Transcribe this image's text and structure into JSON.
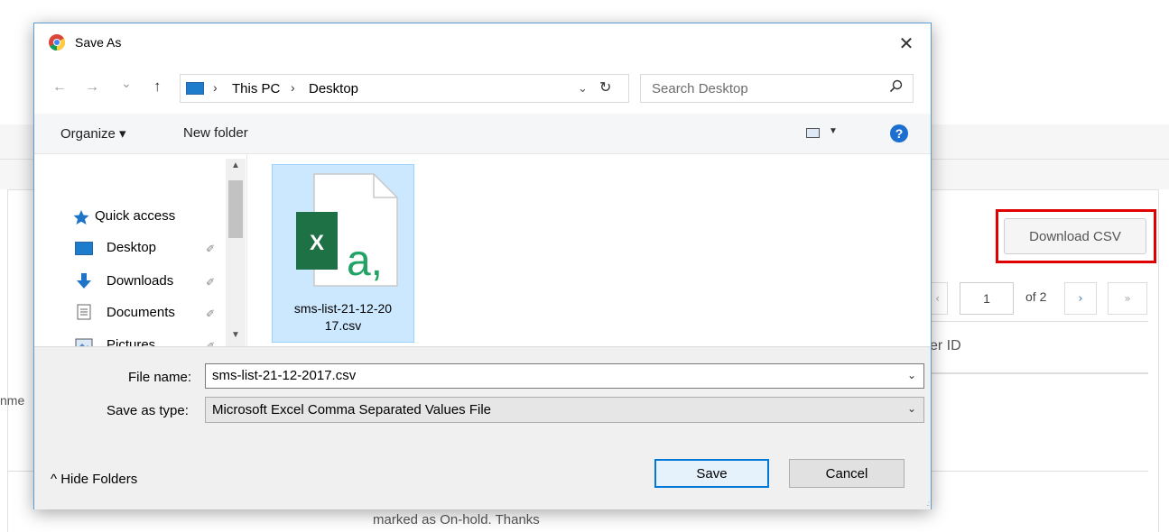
{
  "background": {
    "download_csv_label": "Download CSV",
    "pagination": {
      "prev": "‹",
      "current_page": "1",
      "of_label": "of 2",
      "next": "›",
      "last": "»"
    },
    "table_header_partial": "er ID",
    "left_cut_text": "nme",
    "row_text": "marked as On-hold. Thanks",
    "highlight_color": "#e00000"
  },
  "dialog": {
    "title": "Save As",
    "close_label": "✕",
    "nav": {
      "back": "←",
      "forward": "→",
      "recent": "⌄",
      "up": "↑"
    },
    "address": {
      "parts": [
        "This PC",
        "Desktop"
      ],
      "separator": "›",
      "dropdown": "⌄",
      "refresh": "↻"
    },
    "search": {
      "placeholder": "Search Desktop",
      "icon": "search-icon"
    },
    "toolbar": {
      "organize": "Organize ▾",
      "new_folder": "New folder",
      "help": "?"
    },
    "nav_pane": {
      "items": [
        {
          "label": "Quick access",
          "icon": "star-icon",
          "pinned": false
        },
        {
          "label": "Desktop",
          "icon": "desktop-icon",
          "pinned": true
        },
        {
          "label": "Downloads",
          "icon": "download-arrow-icon",
          "pinned": true
        },
        {
          "label": "Documents",
          "icon": "document-icon",
          "pinned": true
        },
        {
          "label": "Pictures",
          "icon": "pictures-icon",
          "pinned": true
        }
      ],
      "pin_glyph": "✐"
    },
    "files": [
      {
        "name_line1": "sms-list-21-12-20",
        "name_line2": "17.csv",
        "icon": "excel-csv-icon",
        "selected": true
      }
    ],
    "file_name_label": "File name:",
    "file_name_value": "sms-list-21-12-2017.csv",
    "save_type_label": "Save as type:",
    "save_type_value": "Microsoft Excel Comma Separated Values File",
    "hide_folders": "^  Hide Folders",
    "save_button": "Save",
    "cancel_button": "Cancel",
    "colors": {
      "accent": "#0078d7",
      "selection": "#cce8ff",
      "excel_green": "#1e7145"
    }
  }
}
